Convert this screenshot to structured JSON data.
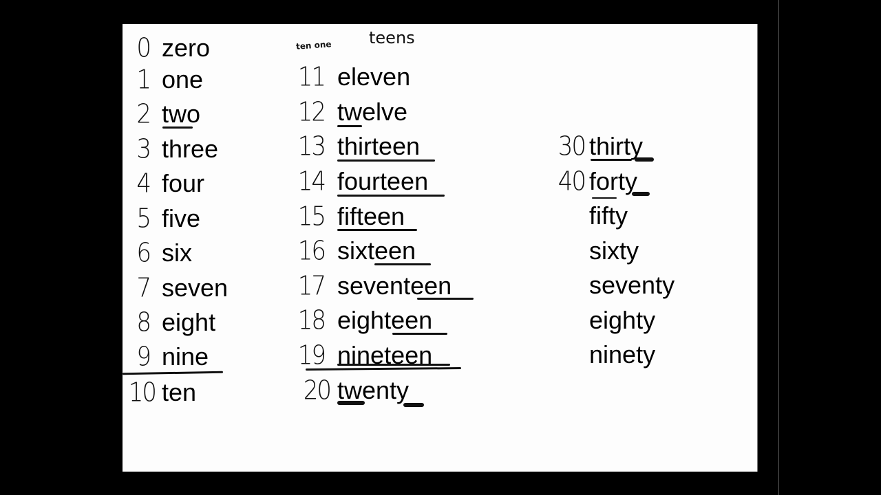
{
  "annotations": {
    "ten_one": "ten one",
    "teens": "teens"
  },
  "col1": [
    {
      "num": "0",
      "word": "zero"
    },
    {
      "num": "1",
      "word": "one"
    },
    {
      "num": "2",
      "word": "two"
    },
    {
      "num": "3",
      "word": "three"
    },
    {
      "num": "4",
      "word": "four"
    },
    {
      "num": "5",
      "word": "five"
    },
    {
      "num": "6",
      "word": "six"
    },
    {
      "num": "7",
      "word": "seven"
    },
    {
      "num": "8",
      "word": "eight"
    },
    {
      "num": "9",
      "word": "nine"
    },
    {
      "num": "10",
      "word": "ten"
    }
  ],
  "col2": [
    {
      "num": "11",
      "word": "eleven"
    },
    {
      "num": "12",
      "word": "twelve"
    },
    {
      "num": "13",
      "word": "thirteen"
    },
    {
      "num": "14",
      "word": "fourteen"
    },
    {
      "num": "15",
      "word": "fifteen"
    },
    {
      "num": "16",
      "word": "sixteen"
    },
    {
      "num": "17",
      "word": "seventeen"
    },
    {
      "num": "18",
      "word": "eighteen"
    },
    {
      "num": "19",
      "word": "nineteen"
    },
    {
      "num": "20",
      "word": "twenty"
    }
  ],
  "col3": [
    {
      "num": "30",
      "word": "thirty"
    },
    {
      "num": "40",
      "word": "forty"
    },
    {
      "num": "",
      "word": "fifty"
    },
    {
      "num": "",
      "word": "sixty"
    },
    {
      "num": "",
      "word": "seventy"
    },
    {
      "num": "",
      "word": "eighty"
    },
    {
      "num": "",
      "word": "ninety"
    }
  ]
}
